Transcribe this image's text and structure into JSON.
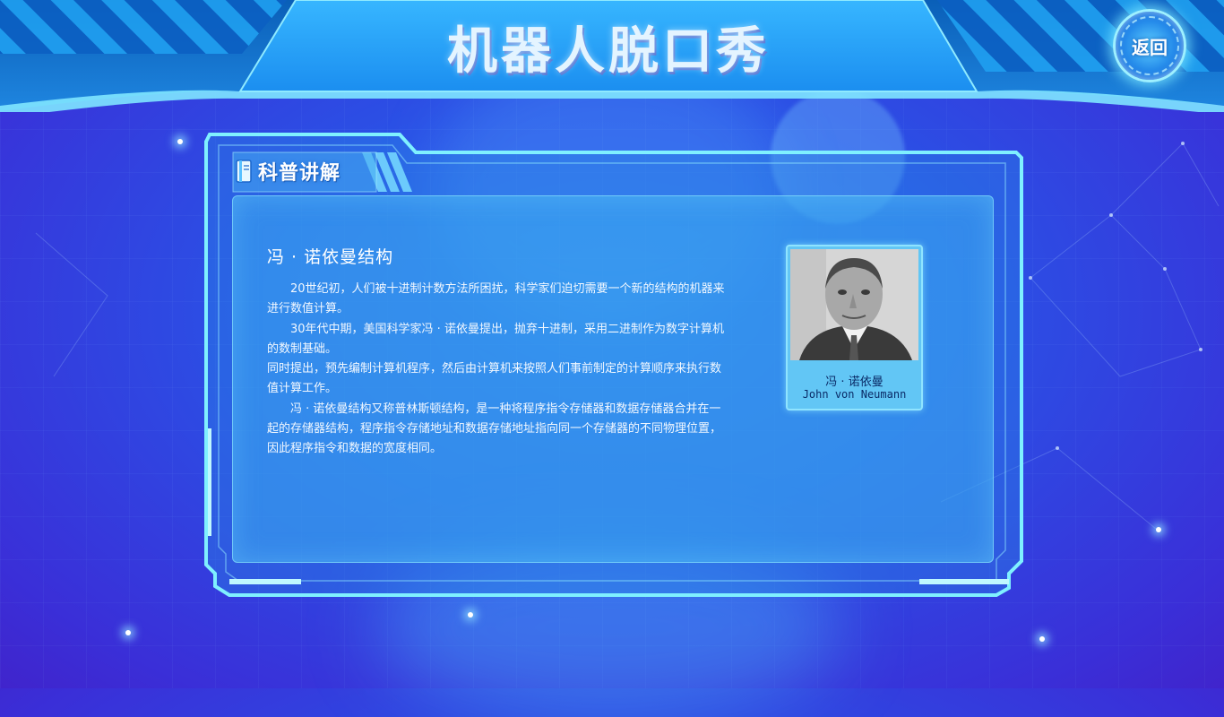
{
  "header": {
    "title": "机器人脱口秀",
    "back_label": "返回"
  },
  "panel": {
    "section_label": "科普讲解",
    "section_icon": "book-icon",
    "article": {
      "title": "冯 · 诺依曼结构",
      "paragraphs": [
        "20世纪初，人们被十进制计数方法所困扰，科学家们迫切需要一个新的结构的机器来进行数值计算。",
        "30年代中期，美国科学家冯 · 诺依曼提出，抛弃十进制，采用二进制作为数字计算机的数制基础。",
        "同时提出，预先编制计算机程序，然后由计算机来按照人们事前制定的计算顺序来执行数值计算工作。",
        "冯 · 诺依曼结构又称普林斯顿结构，是一种将程序指令存储器和数据存储器合并在一起的存储器结构，程序指令存储地址和数据存储地址指向同一个存储器的不同物理位置，因此程序指令和数据的宽度相同。"
      ]
    },
    "portrait": {
      "caption_cn": "冯 · 诺依曼",
      "caption_en": "John von Neumann"
    }
  },
  "colors": {
    "accent": "#5fd8ff",
    "panel_fill": "#3aa8ec",
    "background": "#2f5ae8"
  }
}
